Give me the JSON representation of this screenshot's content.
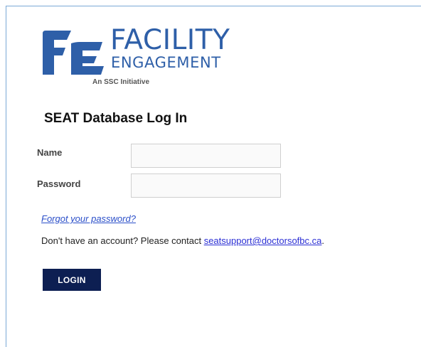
{
  "logo": {
    "word1": "FACILITY",
    "word2": "ENGAGEMENT",
    "tagline": "An SSC Initiative",
    "brand_color": "#2e5fa8"
  },
  "form": {
    "title": "SEAT Database Log In",
    "name_label": "Name",
    "name_value": "",
    "password_label": "Password",
    "password_value": ""
  },
  "links": {
    "forgot": "Forgot your password?",
    "contact_prefix": "Don't have an account? Please contact ",
    "contact_email": "seatsupport@doctorsofbc.ca",
    "contact_suffix": "."
  },
  "actions": {
    "login_label": "LOGIN",
    "login_color": "#0d1f52"
  }
}
